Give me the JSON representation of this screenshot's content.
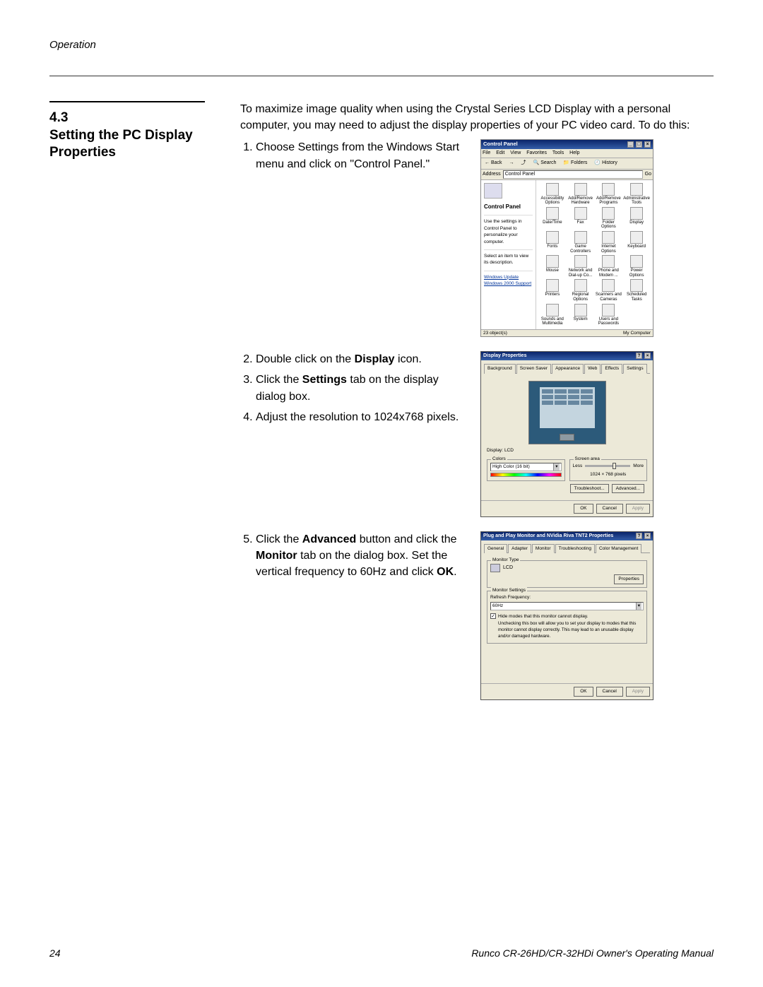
{
  "header": {
    "section_label": "Operation"
  },
  "section": {
    "number": "4.3",
    "title": "Setting the PC Display Properties"
  },
  "intro": "To maximize image quality when using the Crystal Series LCD Display with a personal computer, you may need to adjust the display properties of your PC video card. To do this:",
  "steps1": [
    "Choose Settings from the Windows Start menu and click on \"Control Panel.\""
  ],
  "steps2_start": 2,
  "steps2": [
    {
      "pre": "Double click on the ",
      "bold": "Display",
      "post": " icon."
    },
    {
      "pre": "Click the ",
      "bold": "Settings",
      "post": " tab on the display dialog box."
    },
    {
      "pre": "Adjust the resolution to 1024x768 pixels.",
      "bold": "",
      "post": ""
    }
  ],
  "steps3_start": 5,
  "step3": {
    "p1": "Click the ",
    "b1": "Advanced",
    "p2": " button and click the ",
    "b2": "Monitor",
    "p3": " tab on the dialog box. Set the vertical frequency to 60Hz and click ",
    "b3": "OK",
    "p4": "."
  },
  "cp": {
    "title": "Control Panel",
    "menus": [
      "File",
      "Edit",
      "View",
      "Favorites",
      "Tools",
      "Help"
    ],
    "toolbar": {
      "back": "Back",
      "search": "Search",
      "folders": "Folders",
      "history": "History"
    },
    "addr_label": "Address",
    "addr_value": "Control Panel",
    "go": "Go",
    "side_title": "Control Panel",
    "hint1": "Use the settings in Control Panel to personalize your computer.",
    "hint2": "Select an item to view its description.",
    "links": [
      "Windows Update",
      "Windows 2000 Support"
    ],
    "items": [
      "Accessibility Options",
      "Add/Remove Hardware",
      "Add/Remove Programs",
      "Administrative Tools",
      "Date/Time",
      "Fax",
      "Folder Options",
      "Display",
      "Fonts",
      "Game Controllers",
      "Internet Options",
      "Keyboard",
      "Mouse",
      "Network and Dial-up Co...",
      "Phone and Modem ...",
      "Power Options",
      "Printers",
      "Regional Options",
      "Scanners and Cameras",
      "Scheduled Tasks",
      "Sounds and Multimedia",
      "System",
      "Users and Passwords"
    ],
    "status_left": "23 object(s)",
    "status_right": "My Computer"
  },
  "disp": {
    "title": "Display Properties",
    "tabs": [
      "Background",
      "Screen Saver",
      "Appearance",
      "Web",
      "Effects",
      "Settings"
    ],
    "display_label": "Display:",
    "display_value": "LCD",
    "colors_legend": "Colors",
    "colors_value": "High Color (16 bit)",
    "area_legend": "Screen area",
    "less": "Less",
    "more": "More",
    "resolution": "1024 × 768 pixels",
    "troubleshoot": "Troubleshoot...",
    "advanced": "Advanced...",
    "ok": "OK",
    "cancel": "Cancel",
    "apply": "Apply"
  },
  "adv": {
    "title": "Plug and Play Monitor and NVidia Riva TNT2 Properties",
    "tabs": [
      "General",
      "Adapter",
      "Monitor",
      "Troubleshooting",
      "Color Management"
    ],
    "type_legend": "Monitor Type",
    "monitor_name": "LCD",
    "properties": "Properties",
    "settings_legend": "Monitor Settings",
    "refresh_label": "Refresh Frequency:",
    "refresh_value": "60Hz",
    "hide": "Hide modes that this monitor cannot display.",
    "note": "Unchecking this box will allow you to set your display to modes that this monitor cannot display correctly. This may lead to an unusable display and/or damaged hardware.",
    "ok": "OK",
    "cancel": "Cancel",
    "apply": "Apply"
  },
  "footer": {
    "page": "24",
    "manual": "Runco CR-26HD/CR-32HDi Owner's Operating Manual"
  }
}
